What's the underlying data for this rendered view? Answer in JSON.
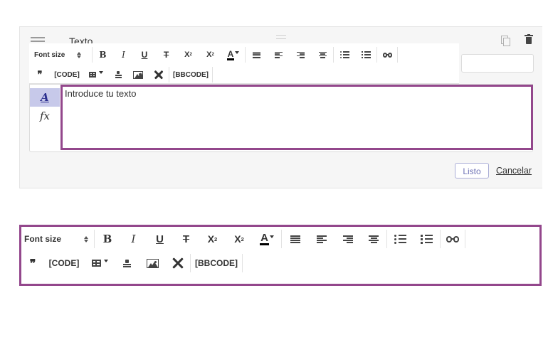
{
  "block": {
    "title": "Texto",
    "done_label": "Listo",
    "cancel_label": "Cancelar",
    "text_placeholder": "Introduce tu texto"
  },
  "side_tools": {
    "text_glyph": "A",
    "formula_glyph": "fx"
  },
  "toolbar": {
    "font_size_label": "Font size",
    "bold": "B",
    "italic": "I",
    "underline": "U",
    "strike": "T",
    "superscript": "X",
    "subscript": "X",
    "sup_mark": "2",
    "sub_mark": "2",
    "color_letter": "A",
    "quote": "❞",
    "code_label": "[CODE]",
    "bbcode_label": "[BBCODE]"
  },
  "icons": [
    "menu-icon",
    "copy-icon",
    "trash-icon",
    "align-left-icon",
    "align-center-icon",
    "align-right-icon",
    "align-justify-icon",
    "bullet-list-icon",
    "numbered-list-icon",
    "link-icon",
    "table-icon",
    "stamp-icon",
    "image-icon",
    "tools-icon"
  ],
  "colors": {
    "highlight_border": "#93478c",
    "active_side_bg": "#c7c9ea",
    "done_text": "#7074b6"
  }
}
